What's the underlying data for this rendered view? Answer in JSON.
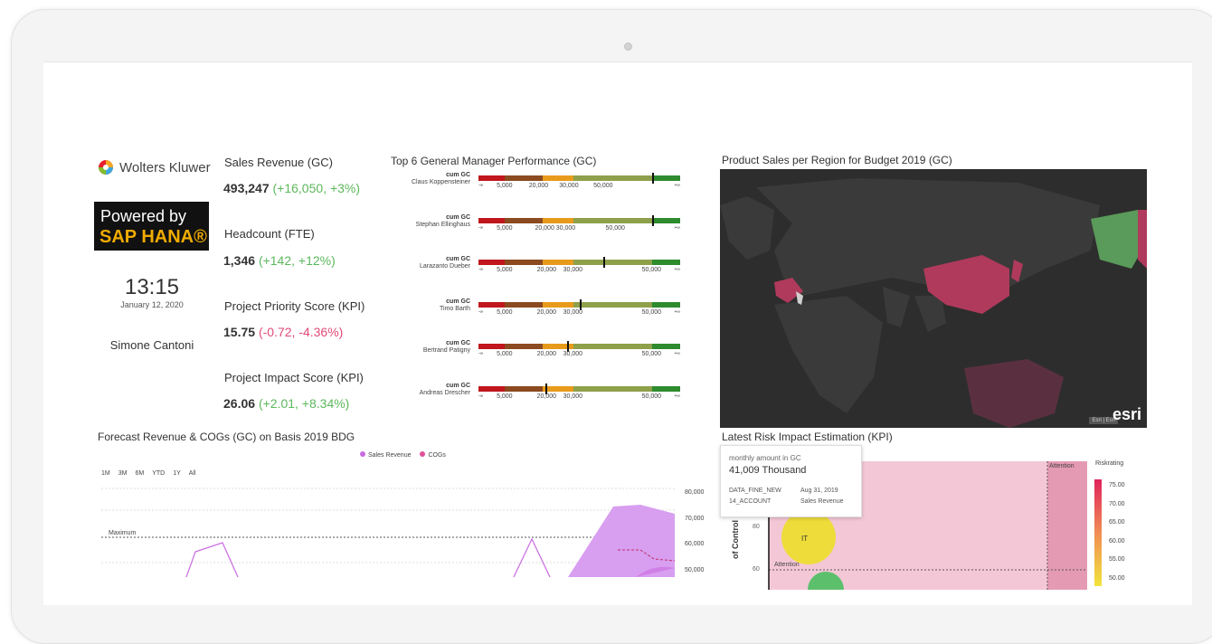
{
  "branding": {
    "company": "Wolters Kluwer",
    "powered_line1": "Powered by",
    "powered_line2": "SAP HANA®"
  },
  "clock": {
    "time": "13:15",
    "date": "January 12, 2020",
    "user": "Simone Cantoni"
  },
  "kpis": [
    {
      "title": "Sales Revenue (GC)",
      "value": "493,247",
      "delta": "(+16,050, +3%)",
      "trend": "pos"
    },
    {
      "title": "Headcount (FTE)",
      "value": "1,346",
      "delta": "(+142, +12%)",
      "trend": "pos"
    },
    {
      "title": "Project Priority Score (KPI)",
      "value": "15.75",
      "delta": "(-0.72, -4.36%)",
      "trend": "neg"
    },
    {
      "title": "Project Impact Score (KPI)",
      "value": "26.06",
      "delta": "(+2.01, +8.34%)",
      "trend": "pos"
    }
  ],
  "gm": {
    "title": "Top 6 General Manager Performance (GC)",
    "measure": "cum GC",
    "inf_min": "-∞",
    "inf_max": "+∞",
    "managers": [
      {
        "name": "Claus Koppensteiner",
        "ticks": [
          "5,000",
          "20,000",
          "30,000",
          "50,000"
        ],
        "marker": 0.86
      },
      {
        "name": "Stephan Ellinghaus",
        "ticks": [
          "5,000",
          "20,000 30,000",
          "50,000"
        ],
        "marker": 0.86
      },
      {
        "name": "Larazanto Dueber",
        "ticks": [
          "5,000",
          "20,000",
          "30,000",
          "50,000"
        ],
        "marker": 0.62
      },
      {
        "name": "Timo Barth",
        "ticks": [
          "5,000",
          "20,000",
          "30,000",
          "50,000"
        ],
        "marker": 0.5
      },
      {
        "name": "Bertrand Patigny",
        "ticks": [
          "5,000",
          "20,000",
          "30,000",
          "50,000"
        ],
        "marker": 0.44
      },
      {
        "name": "Andreas Drescher",
        "ticks": [
          "5,000",
          "20,000",
          "30,000",
          "50,000"
        ],
        "marker": 0.33
      }
    ]
  },
  "map": {
    "title": "Product Sales per Region for Budget 2019 (GC)",
    "attribution": "Esri | Esri",
    "powered": "POWERED BY",
    "logo": "esri"
  },
  "forecast": {
    "title": "Forecast Revenue & COGs (GC) on Basis 2019 BDG",
    "legend": [
      {
        "label": "Sales Revenue",
        "color": "#c96be0"
      },
      {
        "label": "COGs",
        "color": "#e0509a"
      }
    ],
    "ranges": [
      "1M",
      "3M",
      "6M",
      "YTD",
      "1Y",
      "All"
    ],
    "threshold_label": "Maximum",
    "y_ticks": [
      "80,000",
      "70,000",
      "60,000",
      "50,000"
    ]
  },
  "risk": {
    "title": "Latest Risk Impact Estimation (KPI)",
    "tooltip": {
      "label": "monthly amount in GC",
      "value": "41,009 Thousand",
      "field1_key": "DATA_FINE_NEW",
      "field1_val": "Aug 31, 2019",
      "field2_key": "14_ACCOUNT",
      "field2_val": "Sales Revenue"
    },
    "attention_label": "Attention",
    "y_axis_label": "of Control",
    "y_ticks": [
      "80",
      "60"
    ],
    "bubble_label": "IT",
    "legend_title": "Riskrating",
    "legend_ticks": [
      "75.00",
      "70.00",
      "65.00",
      "60.00",
      "55.00",
      "50.00"
    ]
  },
  "colors": {
    "positive": "#5cb85c",
    "negative": "#e24a78",
    "bullet_red": "#c0161c",
    "bullet_brown": "#8b4a1f",
    "bullet_orange": "#e89a1b",
    "bullet_olive": "#8ea04a",
    "bullet_green": "#2e8b2e"
  }
}
